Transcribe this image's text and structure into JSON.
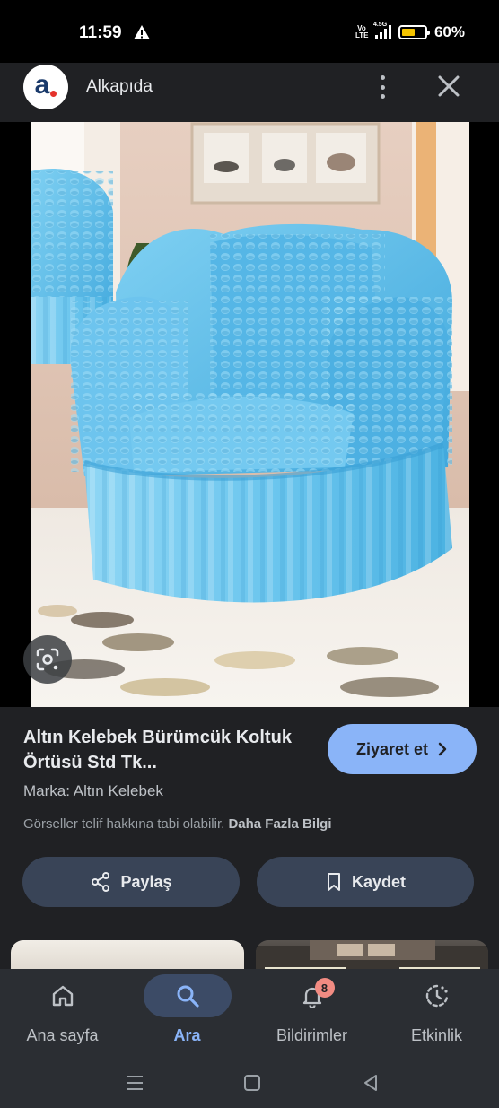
{
  "status_bar": {
    "time": "11:59",
    "volte": "Vo LTE",
    "network": "4.5G",
    "battery": "60%",
    "battery_level": 0.6,
    "battery_color": "#f5c400"
  },
  "header": {
    "logo_letter": "a",
    "site_name": "Alkapıda",
    "more_icon": "more-vert-icon",
    "close_icon": "close-icon"
  },
  "image": {
    "alt": "Altın Kelebek Bürümcük Koltuk Örtüsü",
    "lens_icon": "google-lens-icon"
  },
  "product": {
    "title": "Altın Kelebek Bürümcük Koltuk Örtüsü Std Tk...",
    "brand": "Marka: Altın Kelebek",
    "copyright": "Görseller telif hakkına tabi olabilir.",
    "more_info": "Daha Fazla Bilgi",
    "visit_label": "Ziyaret et",
    "share_label": "Paylaş",
    "save_label": "Kaydet"
  },
  "bottom_nav": {
    "items": [
      {
        "label": "Ana sayfa",
        "icon": "home-icon"
      },
      {
        "label": "Ara",
        "icon": "search-icon"
      },
      {
        "label": "Bildirimler",
        "icon": "bell-icon",
        "badge": "8"
      },
      {
        "label": "Etkinlik",
        "icon": "activity-icon"
      }
    ]
  },
  "colors": {
    "accent": "#8ab4f8",
    "panel": "#202124",
    "pill": "#394457",
    "badge": "#f28b82",
    "chair": "#5cbde8"
  }
}
